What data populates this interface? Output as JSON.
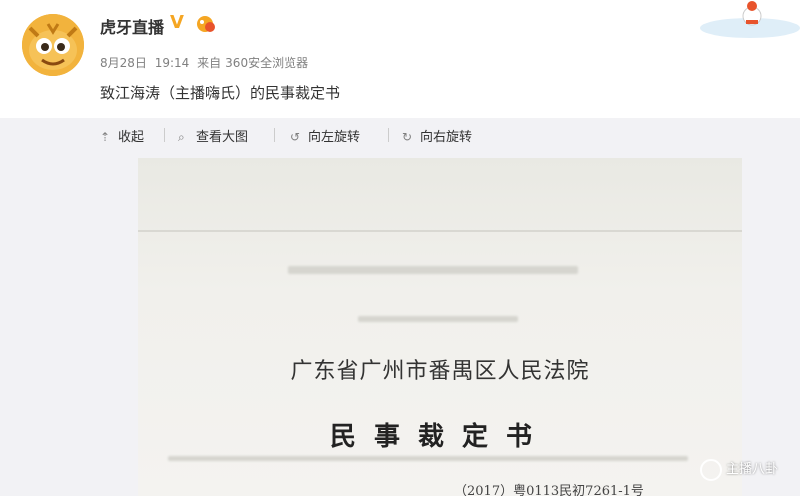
{
  "post": {
    "user_name": "虎牙直播",
    "verified_mark": "V",
    "date": "8月28日",
    "time": "19:14",
    "source_prefix": "来自",
    "source": "360安全浏览器",
    "text": "致江海涛（主播嗨氏）的民事裁定书"
  },
  "toolbar": {
    "collapse": "收起",
    "view_large": "查看大图",
    "rotate_left": "向左旋转",
    "rotate_right": "向右旋转"
  },
  "document": {
    "court_name": "广东省广州市番禺区人民法院",
    "title": "民事裁定书",
    "case_number": "（2017）粤0113民初7261-1号"
  },
  "watermark": {
    "text": "主播八卦"
  },
  "colors": {
    "avatar": "#f2b33d",
    "verified": "#f5a623",
    "meta_text": "#808080",
    "panel_bg": "#f2f2f5"
  }
}
